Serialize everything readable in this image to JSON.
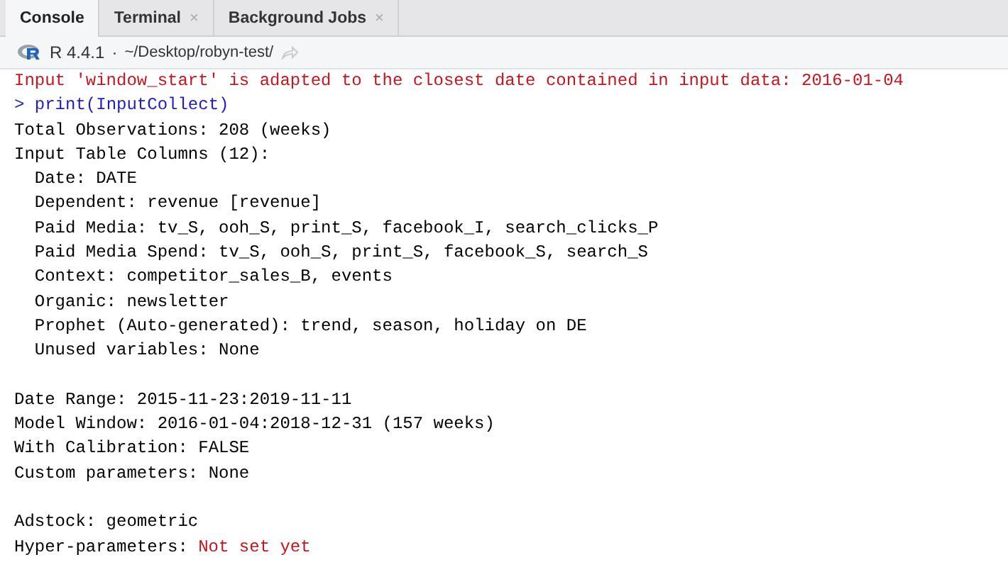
{
  "tabs": [
    {
      "label": "Console",
      "selected": true
    },
    {
      "label": "Terminal",
      "selected": false,
      "close": "×"
    },
    {
      "label": "Background Jobs",
      "selected": false,
      "close": "×"
    }
  ],
  "path_bar": {
    "version": "R 4.4.1",
    "separator": "·",
    "path": "~/Desktop/robyn-test/"
  },
  "console_lines": [
    {
      "kind": "warning",
      "text": "Input 'window_start' is adapted to the closest date contained in input data: 2016-01-04"
    },
    {
      "kind": "command",
      "prompt": ">",
      "text": "print(InputCollect)"
    },
    {
      "kind": "output",
      "text": "Total Observations: 208 (weeks)"
    },
    {
      "kind": "output",
      "text": "Input Table Columns (12):"
    },
    {
      "kind": "output",
      "text": "  Date: DATE"
    },
    {
      "kind": "output",
      "text": "  Dependent: revenue [revenue]"
    },
    {
      "kind": "output",
      "text": "  Paid Media: tv_S, ooh_S, print_S, facebook_I, search_clicks_P"
    },
    {
      "kind": "output",
      "text": "  Paid Media Spend: tv_S, ooh_S, print_S, facebook_S, search_S"
    },
    {
      "kind": "output",
      "text": "  Context: competitor_sales_B, events"
    },
    {
      "kind": "output",
      "text": "  Organic: newsletter"
    },
    {
      "kind": "output",
      "text": "  Prophet (Auto-generated): trend, season, holiday on DE"
    },
    {
      "kind": "output",
      "text": "  Unused variables: None"
    },
    {
      "kind": "blank"
    },
    {
      "kind": "output",
      "text": "Date Range: 2015-11-23:2019-11-11"
    },
    {
      "kind": "output",
      "text": "Model Window: 2016-01-04:2018-12-31 (157 weeks)"
    },
    {
      "kind": "output",
      "text": "With Calibration: FALSE"
    },
    {
      "kind": "output",
      "text": "Custom parameters: None"
    },
    {
      "kind": "blank"
    },
    {
      "kind": "output",
      "text": "Adstock: geometric"
    },
    {
      "kind": "output",
      "text": "Hyper-parameters:",
      "alert": "Not set yet"
    }
  ]
}
